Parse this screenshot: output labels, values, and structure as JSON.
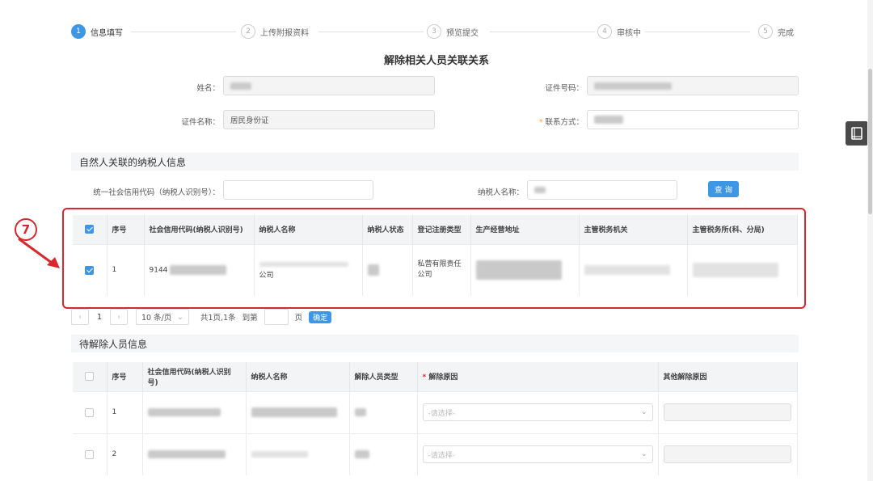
{
  "steps": [
    {
      "num": "1",
      "label": "信息填写"
    },
    {
      "num": "2",
      "label": "上传附报资料"
    },
    {
      "num": "3",
      "label": "预览提交"
    },
    {
      "num": "4",
      "label": "审核中"
    },
    {
      "num": "5",
      "label": "完成"
    }
  ],
  "title": "解除相关人员关联关系",
  "form": {
    "name_label": "姓名：",
    "id_num_label": "证件号码：",
    "id_type_label": "证件名称：",
    "id_type_value": "居民身份证",
    "required_mark": "*",
    "contact_label": "联系方式："
  },
  "section1": {
    "title": "自然人关联的纳税人信息",
    "credit_code_label": "统一社会信用代码（纳税人识别号）：",
    "taxpayer_name_label": "纳税人名称：",
    "query_button": "查 询"
  },
  "table1": {
    "headers": [
      "序号",
      "社会信用代码(纳税人识别号)",
      "纳税人名称",
      "纳税人状态",
      "登记注册类型",
      "生产经营地址",
      "主管税务机关",
      "主管税务所(科、分局)"
    ],
    "rows": [
      {
        "index": "1",
        "code_prefix": "9144",
        "name_suffix": "公司",
        "reg_type": "私营有限责任公司"
      }
    ]
  },
  "marker_label": "7",
  "pager": {
    "prev": "‹",
    "current": "1",
    "next": "›",
    "page_size": "10 条/页",
    "summary": "共1页,1条",
    "goto_label": "到第",
    "page_unit": "页",
    "confirm": "确定"
  },
  "section2": {
    "title": "待解除人员信息"
  },
  "table2": {
    "headers": [
      "序号",
      "社会信用代码(纳税人识别号)",
      "纳税人名称",
      "解除人员类型",
      "解除原因",
      "其他解除原因"
    ],
    "required_mark": "*",
    "select_placeholder": "-请选择-",
    "rows": [
      {
        "index": "1"
      },
      {
        "index": "2"
      }
    ]
  },
  "icons": {
    "side_panel": "book-icon",
    "arrow": "red-arrow-icon"
  },
  "colors": {
    "accent": "#3d96e6",
    "highlight_frame": "#d9272e"
  }
}
